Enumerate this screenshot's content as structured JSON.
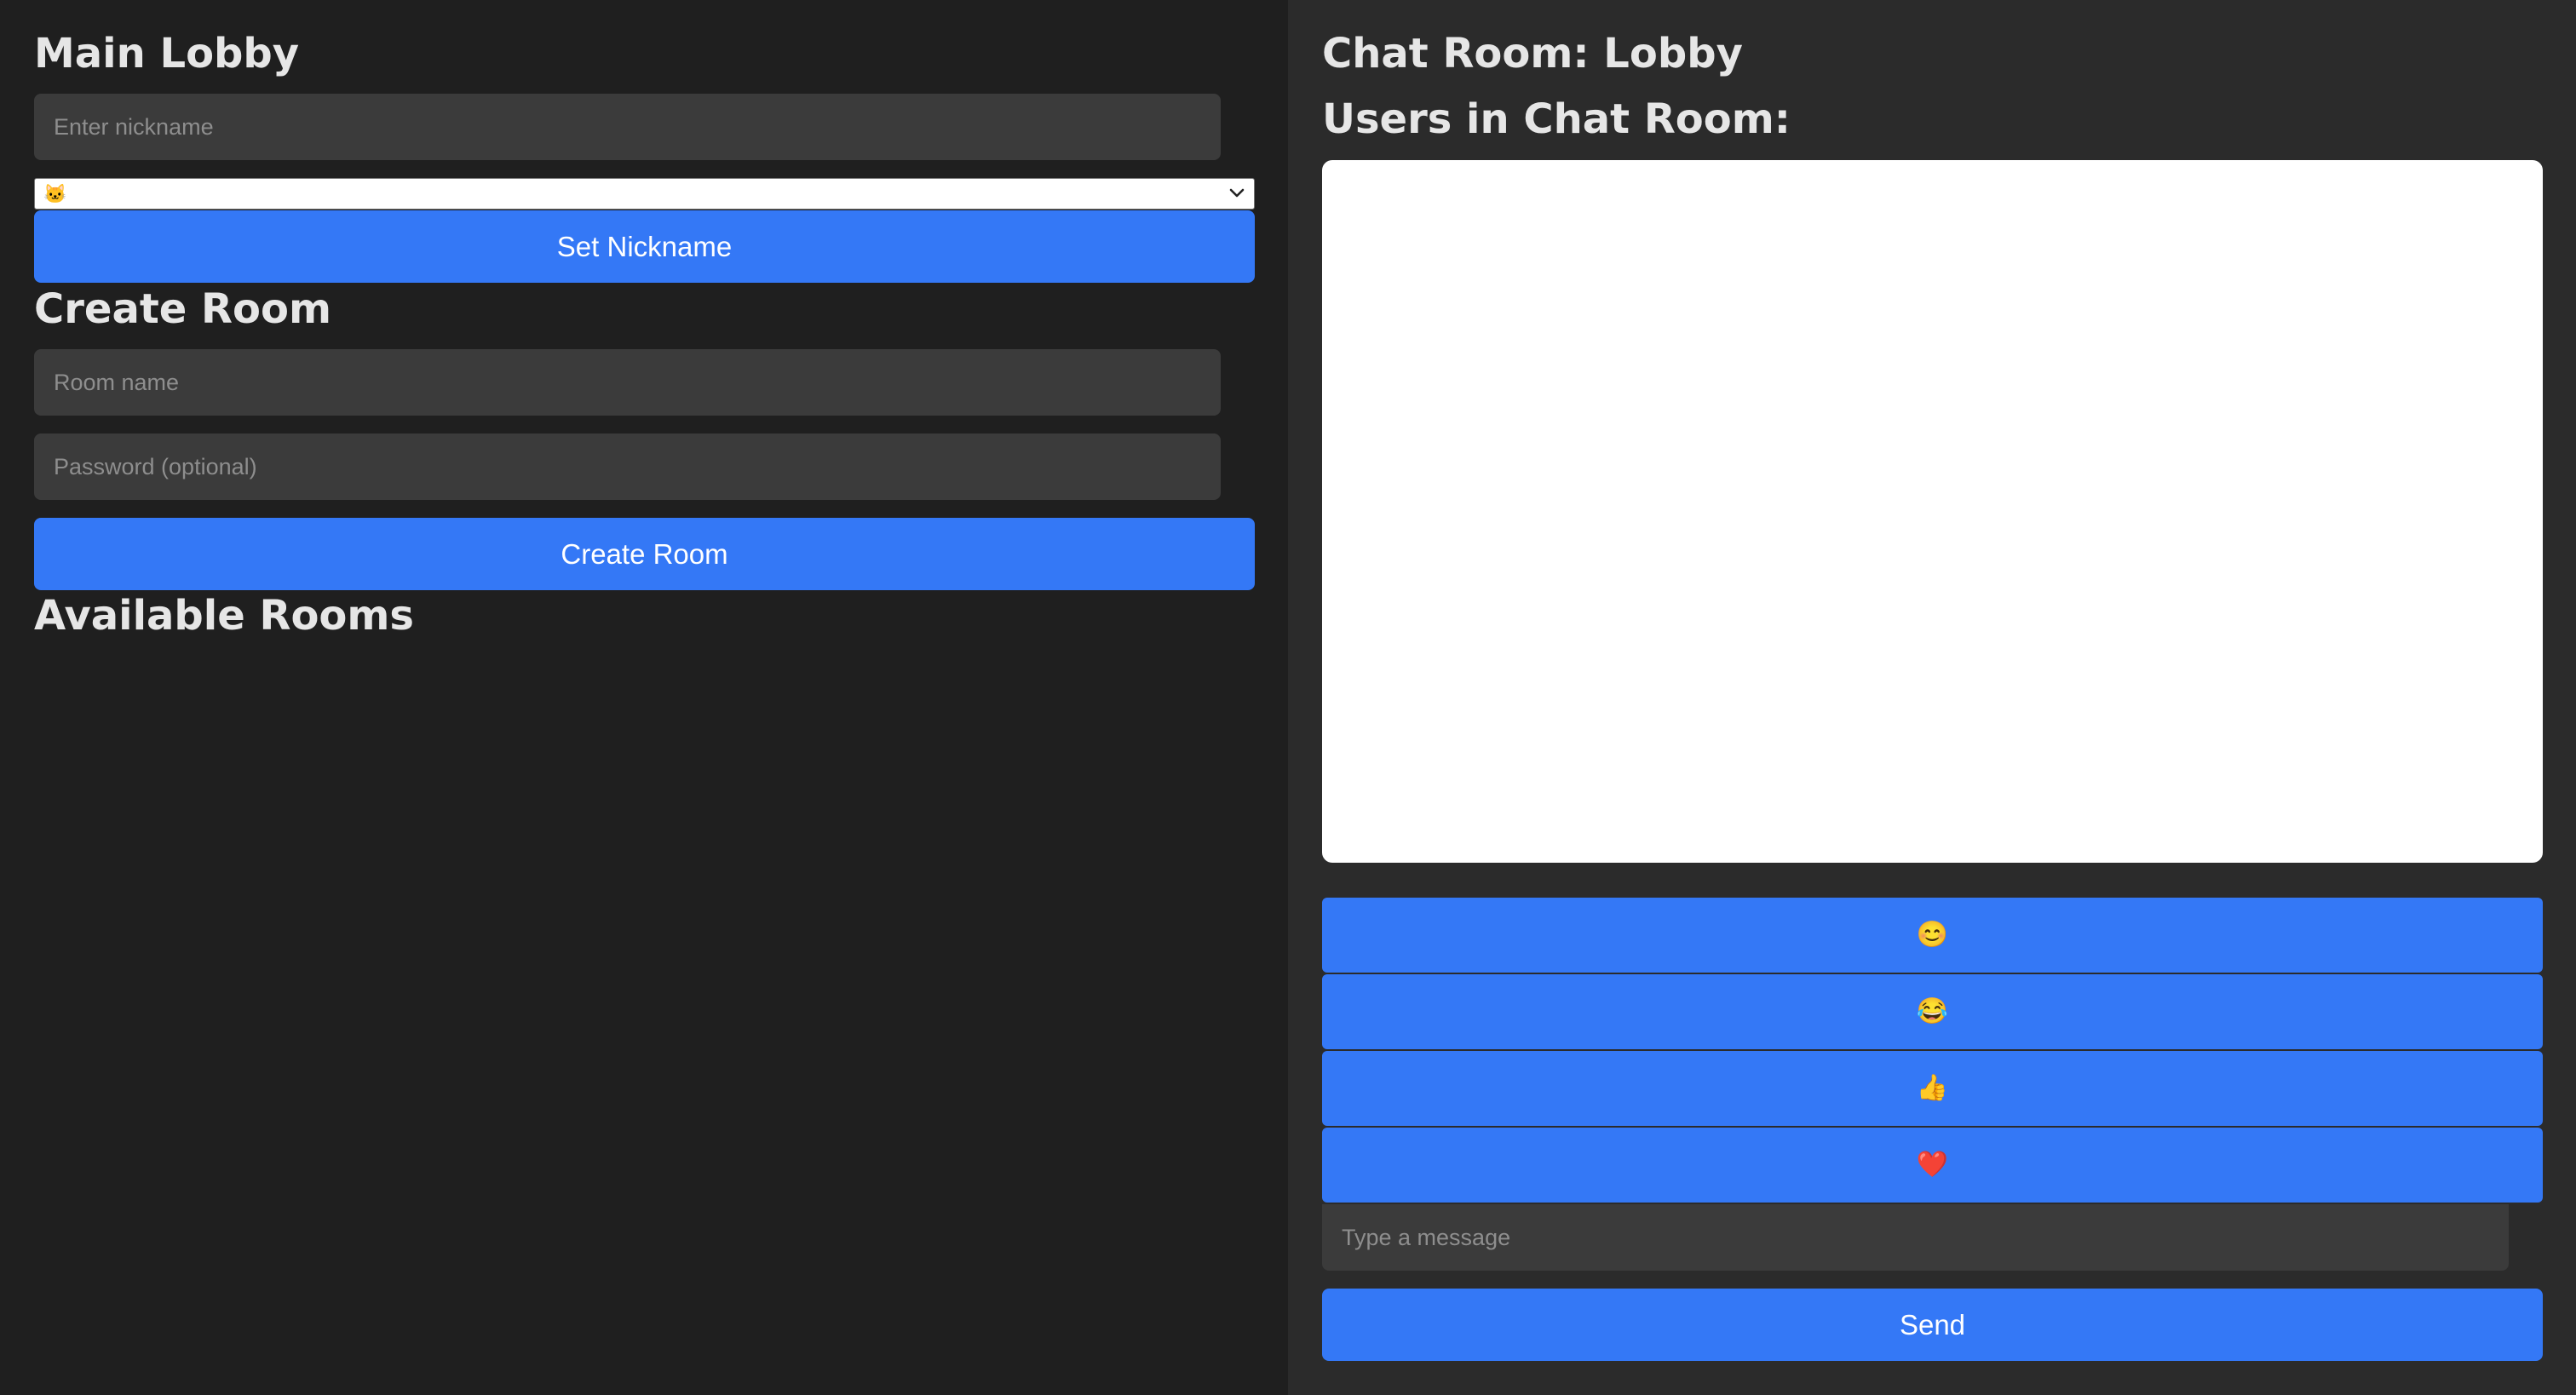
{
  "lobby": {
    "title": "Main Lobby",
    "nickname_placeholder": "Enter nickname",
    "avatar_select_value": "🐱",
    "set_nickname_label": "Set Nickname"
  },
  "create_room": {
    "title": "Create Room",
    "room_name_placeholder": "Room name",
    "password_placeholder": "Password (optional)",
    "create_button_label": "Create Room"
  },
  "available_rooms": {
    "title": "Available Rooms"
  },
  "chat": {
    "title": "Chat Room: Lobby",
    "users_heading": "Users in Chat Room:",
    "emoji_buttons": [
      "😊",
      "😂",
      "👍",
      "❤️"
    ],
    "message_placeholder": "Type a message",
    "send_label": "Send"
  },
  "colors": {
    "left_background": "#1f1f1f",
    "right_background": "#2b2b2b",
    "accent": "#3478f6",
    "input_background": "#3b3b3b"
  }
}
